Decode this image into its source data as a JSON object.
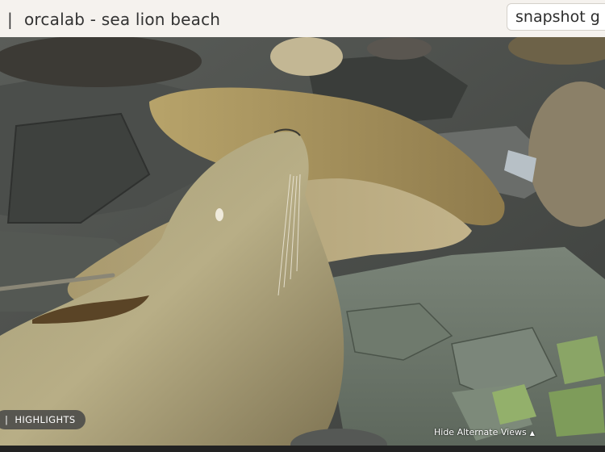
{
  "header": {
    "separator": "|",
    "title": "orcalab - sea lion beach",
    "snapshot_button": "snapshot g"
  },
  "video": {
    "description_icon": "live-camera-feed",
    "highlights_badge": {
      "separator": "|",
      "label": "HIGHLIGHTS"
    },
    "alternate_views": {
      "label": "Hide Alternate Views",
      "arrow": "▲"
    }
  }
}
